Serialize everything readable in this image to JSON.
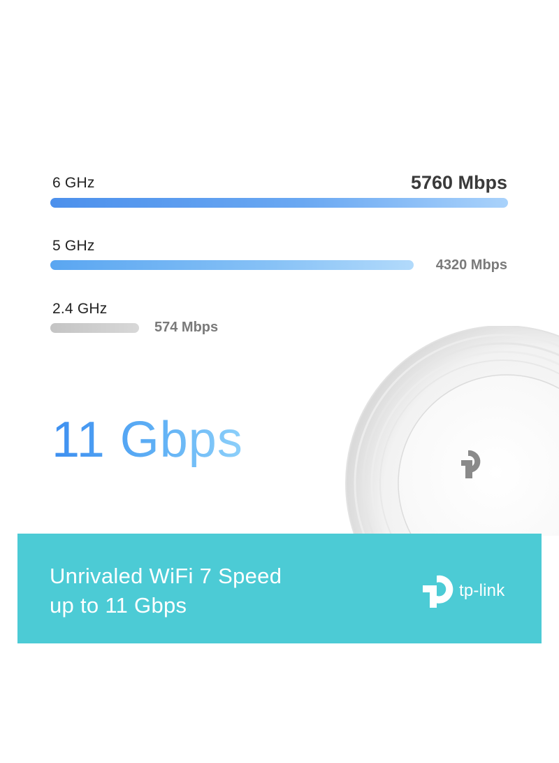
{
  "bands": [
    {
      "label": "6 GHz",
      "speed": "5760 Mbps",
      "fraction": 1.0
    },
    {
      "label": "5 GHz",
      "speed": "4320 Mbps",
      "fraction": 0.75
    },
    {
      "label": "2.4 GHz",
      "speed": "574 Mbps",
      "fraction": 0.1
    }
  ],
  "headline": {
    "total": "11 Gbps"
  },
  "banner": {
    "line1": "Unrivaled WiFi 7 Speed",
    "line2": "up to 11 Gbps",
    "brand": "tp-link"
  },
  "colors": {
    "banner": "#4ccbd5",
    "bar_6ghz": "#4c90ec",
    "bar_5ghz": "#5aa6f1",
    "bar_24ghz": "#c4c4c4",
    "headline": "#3d8ff0"
  },
  "icons": {
    "device_logo": "tp-link-logo-icon",
    "brand_logo": "tp-link-logo-icon"
  }
}
